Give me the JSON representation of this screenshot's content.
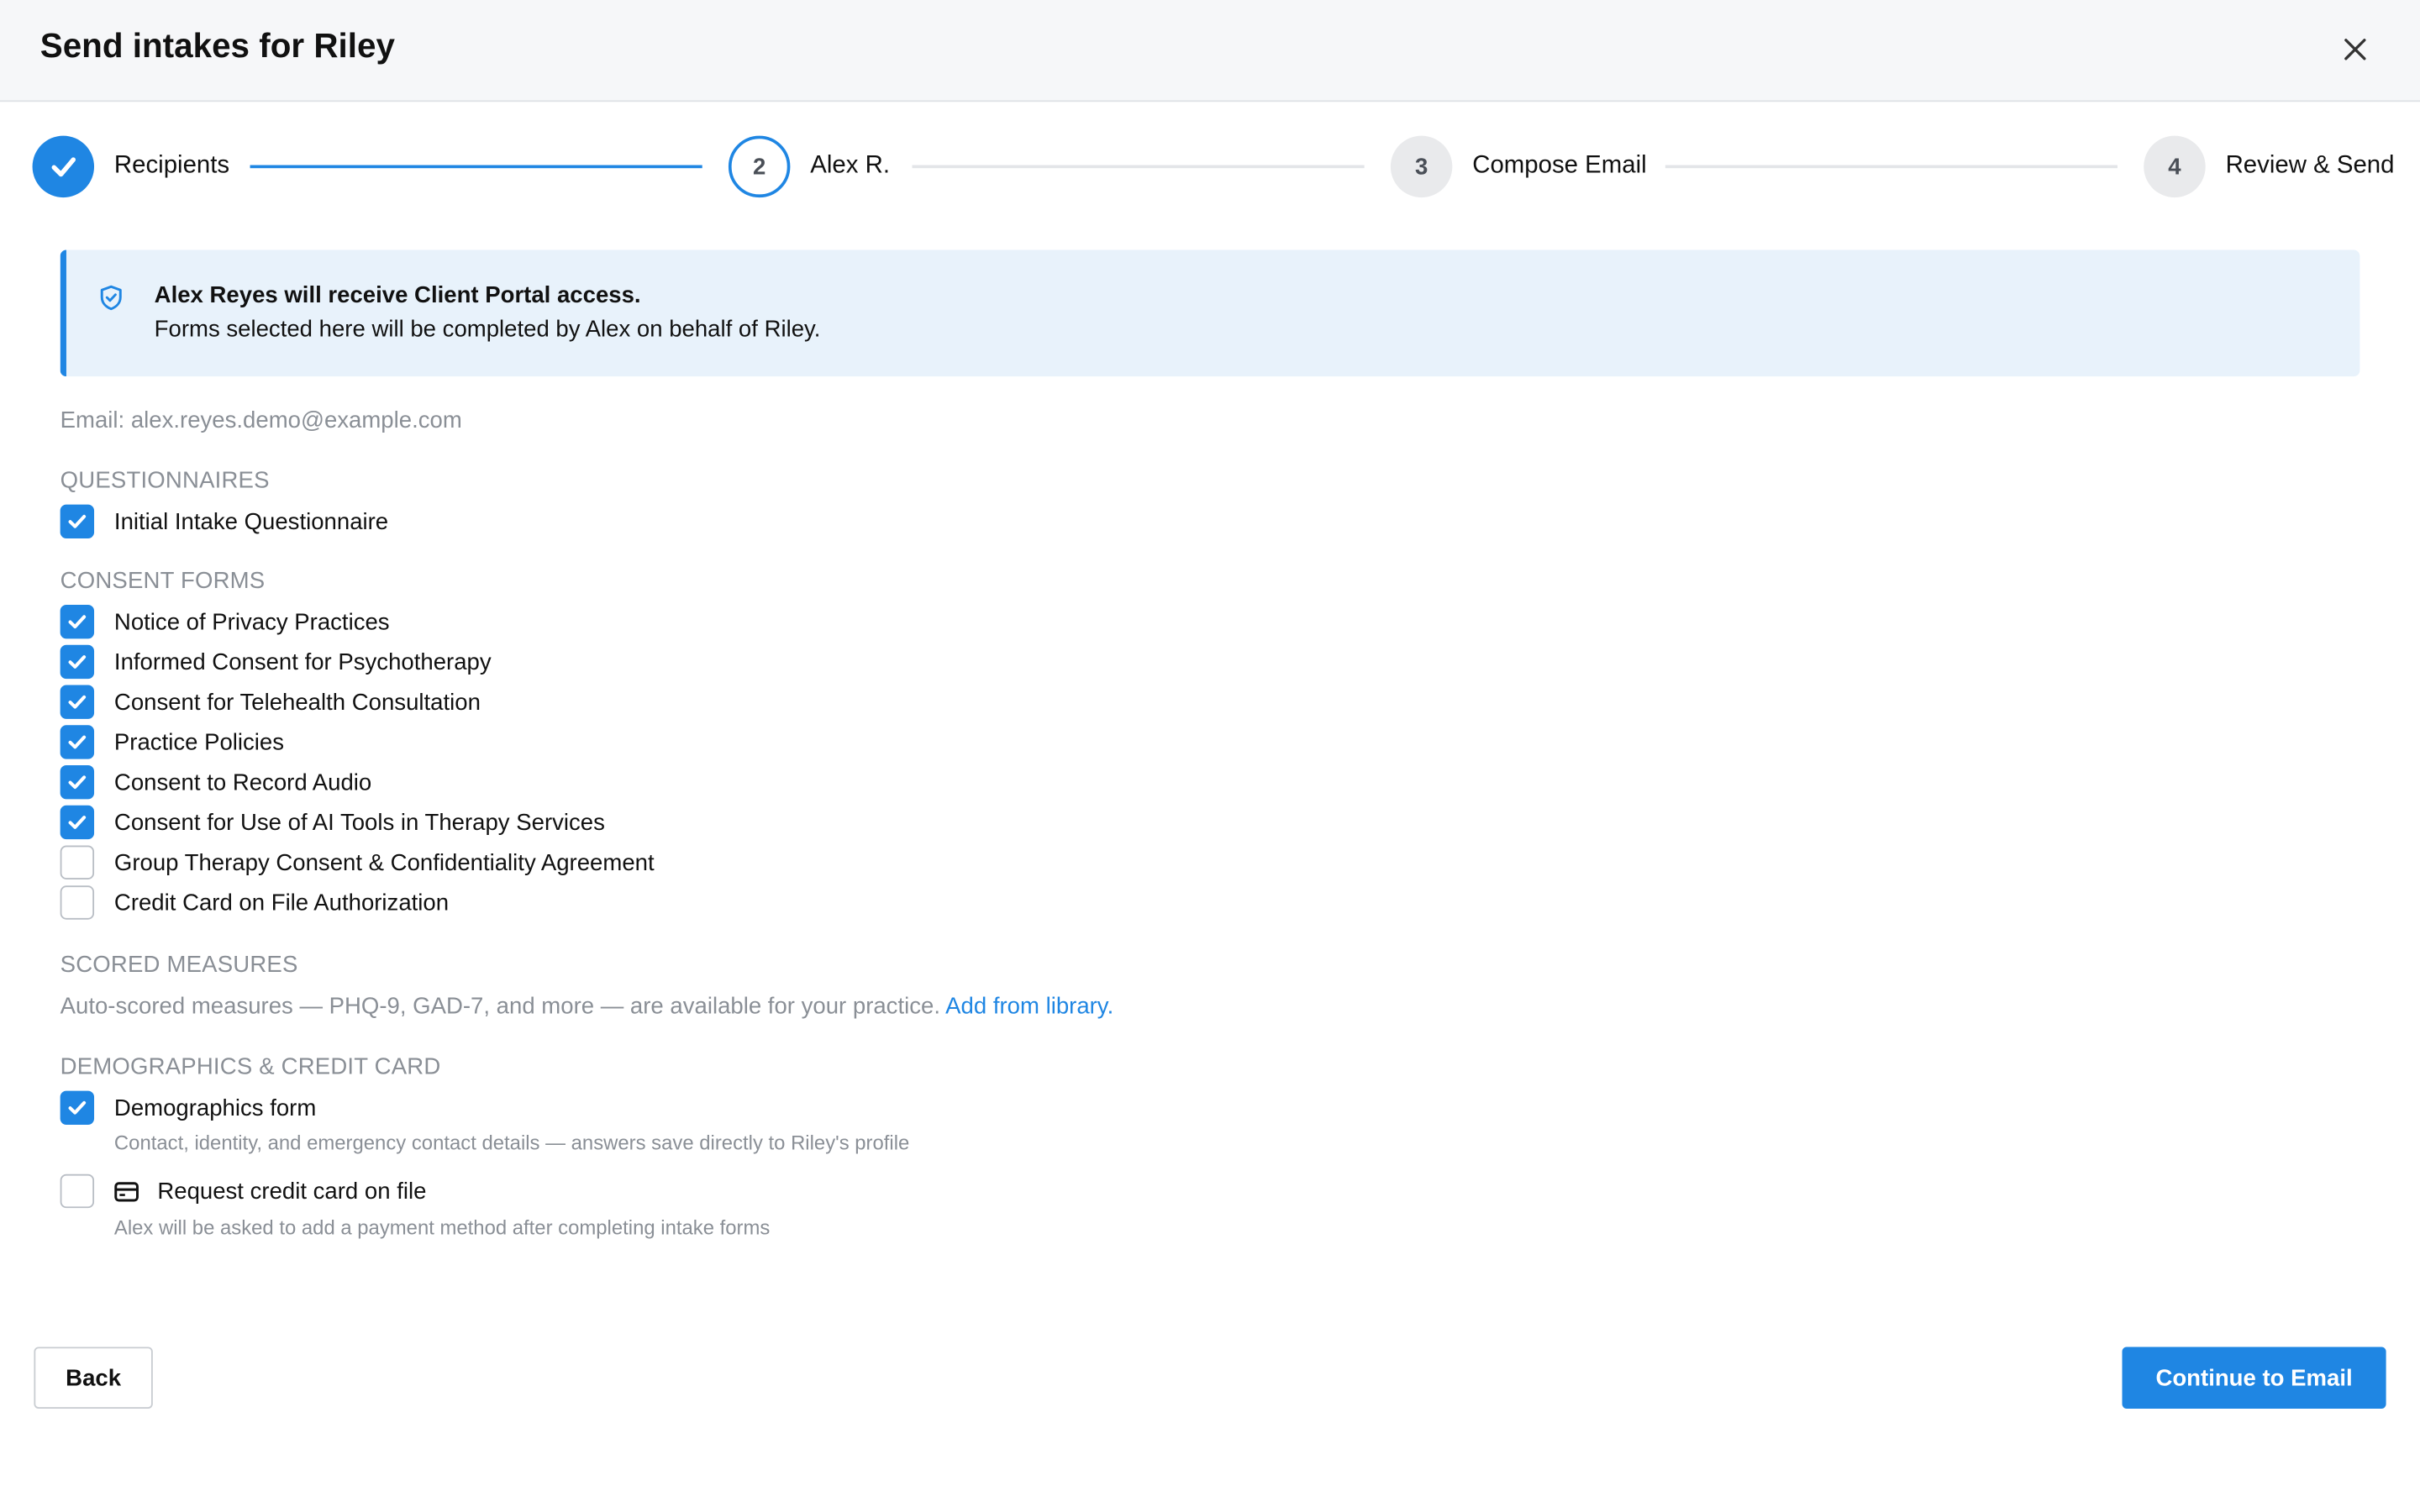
{
  "header": {
    "title": "Send intakes for Riley"
  },
  "stepper": {
    "steps": [
      {
        "number": "",
        "label": "Recipients",
        "state": "done"
      },
      {
        "number": "2",
        "label": "Alex R.",
        "state": "active"
      },
      {
        "number": "3",
        "label": "Compose Email",
        "state": "todo"
      },
      {
        "number": "4",
        "label": "Review & Send",
        "state": "todo"
      }
    ]
  },
  "banner": {
    "title": "Alex Reyes will receive Client Portal access.",
    "body": "Forms selected here will be completed by Alex on behalf of Riley."
  },
  "email_line": "Email: alex.reyes.demo@example.com",
  "questionnaires": {
    "title": "QUESTIONNAIRES",
    "items": [
      {
        "label": "Initial Intake Questionnaire",
        "checked": true
      }
    ]
  },
  "consent_forms": {
    "title": "CONSENT FORMS",
    "items": [
      {
        "label": "Notice of Privacy Practices",
        "checked": true
      },
      {
        "label": "Informed Consent for Psychotherapy",
        "checked": true
      },
      {
        "label": "Consent for Telehealth Consultation",
        "checked": true
      },
      {
        "label": "Practice Policies",
        "checked": true
      },
      {
        "label": "Consent to Record Audio",
        "checked": true
      },
      {
        "label": "Consent for Use of AI Tools in Therapy Services",
        "checked": true
      },
      {
        "label": "Group Therapy Consent & Confidentiality Agreement",
        "checked": false
      },
      {
        "label": "Credit Card on File Authorization",
        "checked": false
      }
    ]
  },
  "scored_measures": {
    "title": "SCORED MEASURES",
    "text": "Auto-scored measures — PHQ-9, GAD-7, and more — are available for your practice.",
    "link": "Add from library",
    "link_suffix": "."
  },
  "demographics": {
    "title": "DEMOGRAPHICS & CREDIT CARD",
    "demographics_form": {
      "label": "Demographics form",
      "checked": true,
      "description": "Contact, identity, and emergency contact details — answers save directly to Riley's profile"
    },
    "credit_card": {
      "label": "Request credit card on file",
      "checked": false,
      "icon": "credit-card-icon",
      "description": "Alex will be asked to add a payment method after completing intake forms"
    }
  },
  "footer": {
    "back_label": "Back",
    "continue_label": "Continue to Email"
  },
  "colors": {
    "accent": "#1f86e3",
    "banner_bg": "#e8f2fb",
    "muted_text": "#8a8f96"
  }
}
